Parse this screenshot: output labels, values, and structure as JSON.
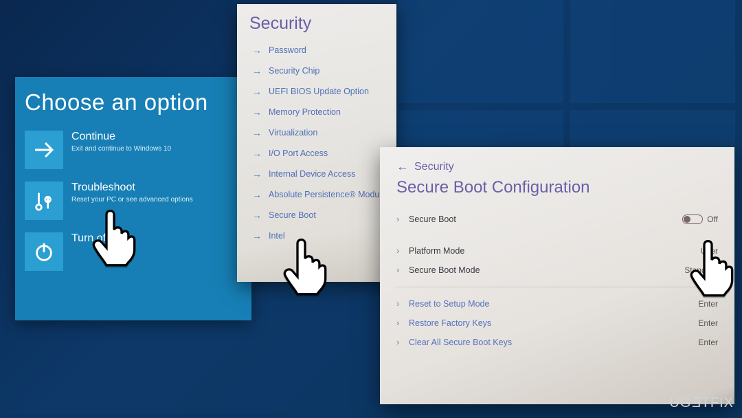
{
  "watermark": "UGETFIX",
  "winre": {
    "title": "Choose an option",
    "tiles": [
      {
        "title": "Continue",
        "sub": "Exit and continue to Windows 10",
        "icon": "arrow"
      },
      {
        "title": "Troubleshoot",
        "sub": "Reset your PC or see advanced options",
        "icon": "tools"
      },
      {
        "title": "Turn off",
        "sub": "",
        "icon": "power"
      }
    ]
  },
  "securityMenu": {
    "title": "Security",
    "items": [
      "Password",
      "Security Chip",
      "UEFI BIOS Update Option",
      "Memory Protection",
      "Virtualization",
      "I/O Port Access",
      "Internal Device Access",
      "Absolute Persistence® Module",
      "Secure Boot",
      "Intel"
    ]
  },
  "secureBoot": {
    "breadcrumb": "Security",
    "title": "Secure Boot Configuration",
    "rows": {
      "secureBoot": {
        "label": "Secure Boot",
        "value": "Off"
      },
      "platformMode": {
        "label": "Platform Mode",
        "value": "User"
      },
      "secureBootMode": {
        "label": "Secure Boot Mode",
        "value": "Standard"
      }
    },
    "actions": [
      {
        "label": "Reset to Setup Mode",
        "value": "Enter"
      },
      {
        "label": "Restore Factory Keys",
        "value": "Enter"
      },
      {
        "label": "Clear All Secure Boot Keys",
        "value": "Enter"
      }
    ]
  }
}
